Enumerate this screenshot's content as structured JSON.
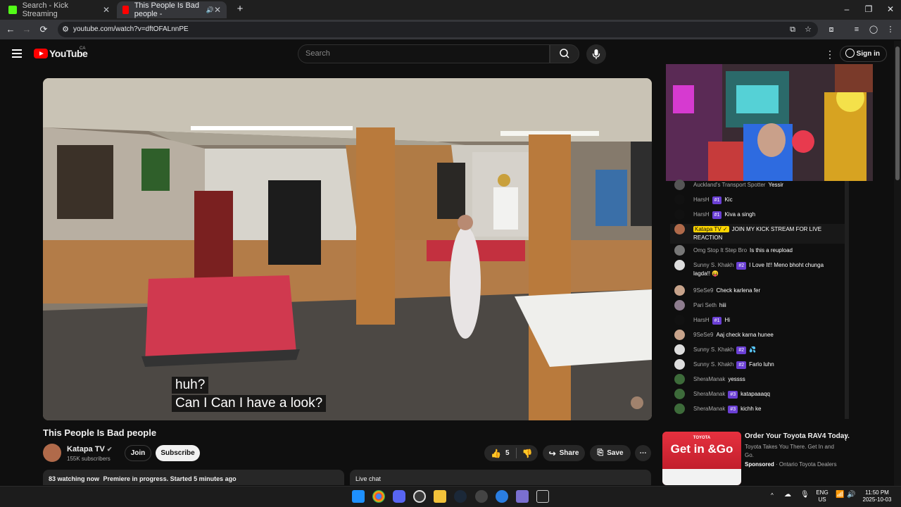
{
  "browser": {
    "tabs": [
      {
        "title": "Search - Kick Streaming",
        "active": false
      },
      {
        "title": "This People Is Bad people -",
        "active": true
      }
    ],
    "new_tab": "+",
    "url": "youtube.com/watch?v=dftOFALnnPE",
    "window_controls": {
      "minimize": "–",
      "maximize": "❐",
      "close": "✕"
    },
    "nav": {
      "back": "←",
      "forward": "→",
      "reload": "⟳"
    }
  },
  "youtube": {
    "logo_text": "YouTube",
    "region": "CA",
    "search_placeholder": "Search",
    "sign_in": "Sign in"
  },
  "video": {
    "captions": [
      "huh?",
      "Can I Can I have a look?"
    ],
    "title": "This People Is Bad people",
    "channel": {
      "name": "Katapa TV",
      "subscribers": "155K subscribers"
    },
    "join": "Join",
    "subscribe": "Subscribe",
    "likes": "5",
    "share": "Share",
    "save": "Save",
    "watching": "83 watching now",
    "premiere": "Premiere in progress. Started 5 minutes ago",
    "live_chat": "Live chat"
  },
  "chat": [
    {
      "name": "Auckland's Transport Spotter",
      "badge": "",
      "text": "Yessir",
      "avatar_color": "#555555"
    },
    {
      "name": "HarsH",
      "badge": "#1",
      "text": "Kic",
      "avatar_color": "#111111"
    },
    {
      "name": "HarsH",
      "badge": "#1",
      "text": "Kiva a singh",
      "avatar_color": "#111111"
    },
    {
      "name": "Katapa TV ✓",
      "badge": "",
      "text": "JOIN MY KICK STREAM FOR LIVE REACTION",
      "avatar_color": "#b06a4a",
      "owner": true
    },
    {
      "name": "Omg Stop It Step Bro",
      "badge": "",
      "text": "Is this a reupload",
      "avatar_color": "#777777"
    },
    {
      "name": "Sunny S. Khakh",
      "badge": "#2",
      "text": "I Love It!! Meno bhoht chunga lagda!! 😝",
      "avatar_color": "#dddddd"
    },
    {
      "name": "9SeSe9",
      "badge": "",
      "text": "Check karlena fer",
      "avatar_color": "#c7a38b"
    },
    {
      "name": "Pari Seth",
      "badge": "",
      "text": "hiii",
      "avatar_color": "#8d7c8e"
    },
    {
      "name": "HarsH",
      "badge": "#1",
      "text": "Hi",
      "avatar_color": "#111111"
    },
    {
      "name": "9SeSe9",
      "badge": "",
      "text": "Aaj check karna hunee",
      "avatar_color": "#c7a38b"
    },
    {
      "name": "Sunny S. Khakh",
      "badge": "#2",
      "text": "💦",
      "avatar_color": "#dddddd"
    },
    {
      "name": "Sunny S. Khakh",
      "badge": "#2",
      "text": "Farlo luhn",
      "avatar_color": "#dddddd"
    },
    {
      "name": "SheraManak",
      "badge": "",
      "text": "yessss",
      "avatar_color": "#3d6b3a"
    },
    {
      "name": "SheraManak",
      "badge": "#3",
      "text": "katapaaaqq",
      "avatar_color": "#3d6b3a"
    },
    {
      "name": "SheraManak",
      "badge": "#3",
      "text": "kichh ke",
      "avatar_color": "#3d6b3a"
    }
  ],
  "ad": {
    "brand": "TOYOTA",
    "tagline": "Get in &Go",
    "title": "Order Your Toyota RAV4 Today.",
    "desc": "Toyota Takes You There. Get In and Go.",
    "sponsored": "Sponsored",
    "advertiser": "Ontario Toyota Dealers"
  },
  "taskbar": {
    "lang": "ENG",
    "region": "US",
    "time": "11:50 PM",
    "date": "2025-10-03",
    "tray_arrow": "^"
  }
}
